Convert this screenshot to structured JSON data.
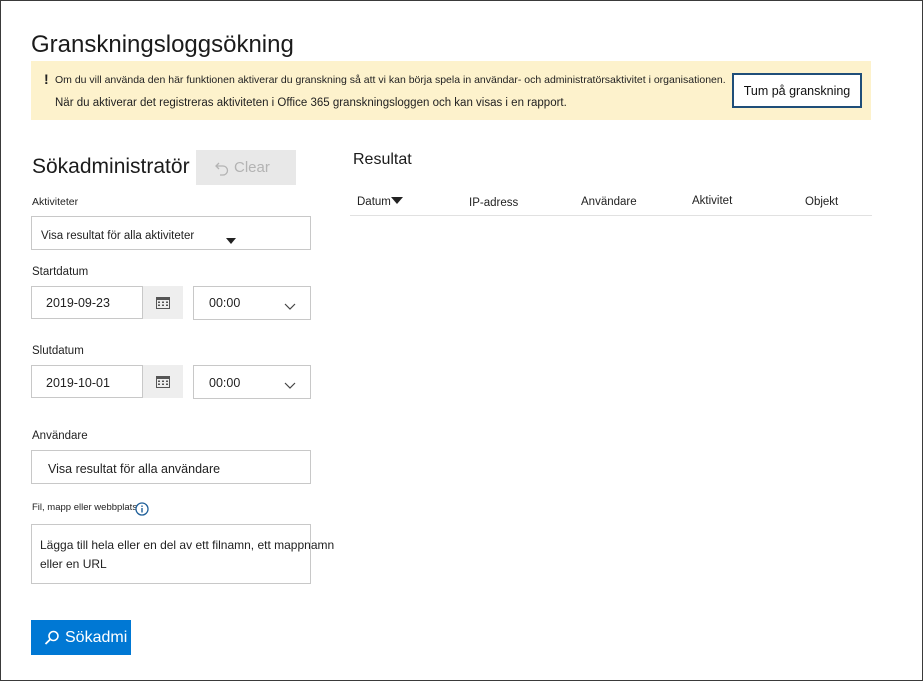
{
  "page": {
    "title": "Granskningsloggsökning"
  },
  "banner": {
    "icon": "!",
    "line1": "Om du vill använda den här funktionen aktiverar du granskning så att vi kan börja spela in användar- och administratörsaktivitet i organisationen.",
    "line2": "När du aktiverar det registreras aktiviteten i Office 365 granskningsloggen och kan visas i en rapport.",
    "button_label": "Tum på granskning"
  },
  "search": {
    "title": "Sökadministratör",
    "clear_label": "Clear",
    "activities": {
      "label": "Aktiviteter",
      "value": "Visa resultat för alla aktiviteter"
    },
    "start": {
      "label": "Startdatum",
      "date": "2019-09-23",
      "time": "00:00"
    },
    "end": {
      "label": "Slutdatum",
      "date": "2019-10-01",
      "time": "00:00"
    },
    "users": {
      "label": "Användare",
      "value": "Visa resultat för alla användare"
    },
    "file": {
      "label": "Fil, mapp eller webbplats",
      "placeholder": "Lägga till hela eller en del av ett filnamn, ett mappnamn eller en URL"
    },
    "search_button_label": "Sökadmi"
  },
  "results": {
    "title": "Resultat",
    "columns": [
      "Datum",
      "IP-adress",
      "Användare",
      "Aktivitet",
      "Objekt"
    ]
  },
  "colors": {
    "accent": "#0078d4",
    "banner_bg": "#fdf2cc",
    "banner_button_border": "#1f4e79"
  }
}
